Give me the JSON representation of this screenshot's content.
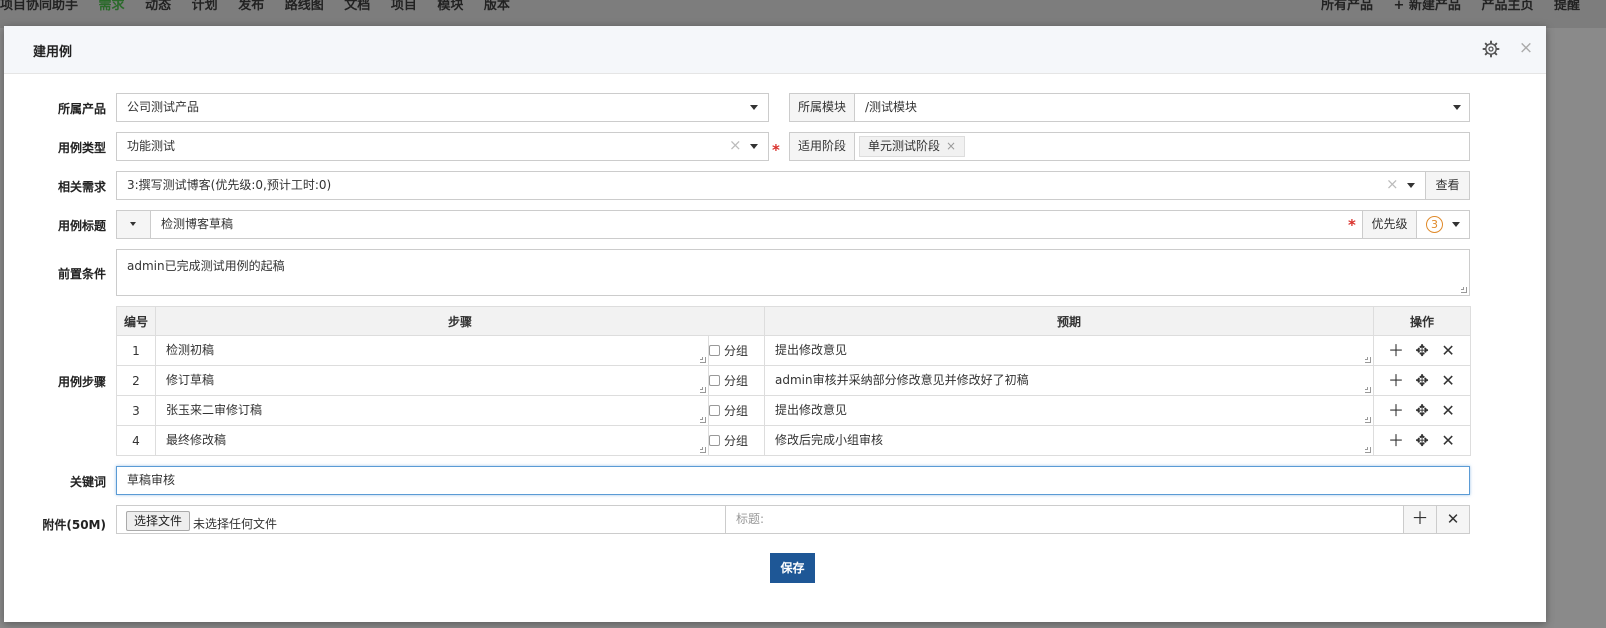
{
  "topbar": {
    "left_items": [
      "项目协同助手",
      "需求",
      "动态",
      "计划",
      "发布",
      "路线图",
      "文档",
      "项目",
      "模块",
      "版本"
    ],
    "right_items": [
      "所有产品",
      "+ 新建产品",
      "产品主页",
      "提醒"
    ]
  },
  "modal": {
    "title": "建用例",
    "settings_icon": "gear-icon",
    "close_icon": "close-icon",
    "close_glyph": "×"
  },
  "form": {
    "product": {
      "label": "所属产品",
      "value": "公司测试产品"
    },
    "module": {
      "label": "所属模块",
      "value": "/测试模块"
    },
    "case_type": {
      "label": "用例类型",
      "value": "功能测试"
    },
    "stage": {
      "label": "适用阶段",
      "chips": [
        "单元测试阶段"
      ]
    },
    "story": {
      "label": "相关需求",
      "value": "3:撰写测试博客(优先级:0,预计工时:0)",
      "view_button": "查看"
    },
    "title": {
      "label": "用例标题",
      "value": "检测博客草稿"
    },
    "priority": {
      "label": "优先级",
      "value": "3"
    },
    "precondition": {
      "label": "前置条件",
      "value": "admin已完成测试用例的起稿"
    },
    "steps": {
      "label": "用例步骤",
      "headers": {
        "num": "编号",
        "step": "步骤",
        "expect": "预期",
        "ops": "操作"
      },
      "group_label": "分组",
      "rows": [
        {
          "num": "1",
          "step": "检测初稿",
          "expect": "提出修改意见"
        },
        {
          "num": "2",
          "step": "修订草稿",
          "expect": "admin审核并采纳部分修改意见并修改好了初稿"
        },
        {
          "num": "3",
          "step": "张玉来二审修订稿",
          "expect": "提出修改意见"
        },
        {
          "num": "4",
          "step": "最终修改稿",
          "expect": "修改后完成小组审核"
        }
      ]
    },
    "keywords": {
      "label": "关键词",
      "value": "草稿审核"
    },
    "attachment": {
      "label": "附件(50M)",
      "choose_button": "选择文件",
      "no_file": "未选择任何文件",
      "title_placeholder": "标题:"
    },
    "save_button": "保存",
    "required_mark": "*",
    "clear_mark": "×"
  },
  "colors": {
    "primary": "#1e5796",
    "required": "#d9302b",
    "priority": "#e08a2a",
    "focus_border": "#5b9bd5"
  }
}
